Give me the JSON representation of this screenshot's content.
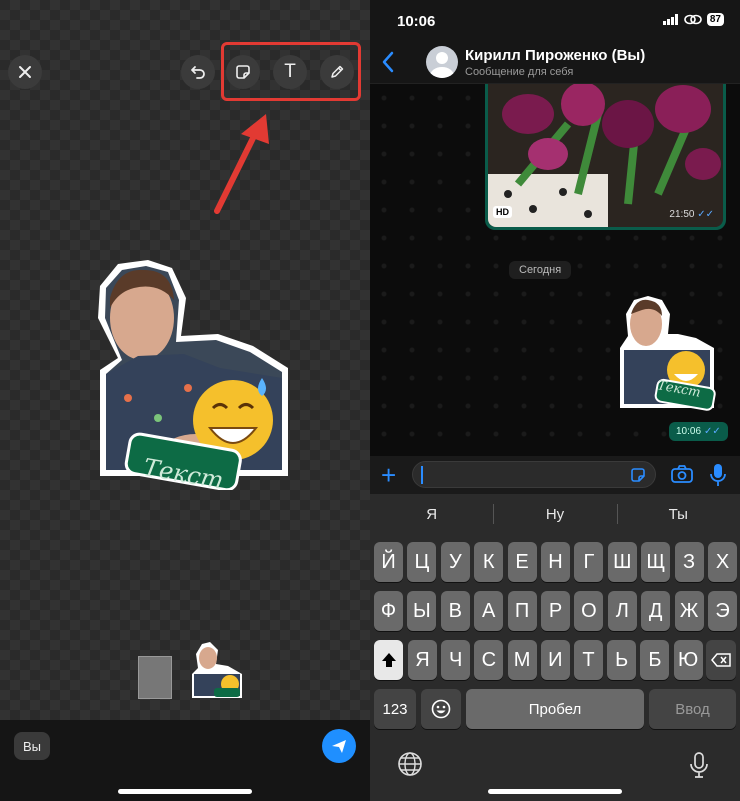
{
  "editor": {
    "close_icon": "close-icon",
    "undo_icon": "undo-icon",
    "sticker_icon": "sticker-icon",
    "text_tool_label": "T",
    "draw_icon": "pencil-icon",
    "sticker_text": "Текст",
    "recipient_chip": "Вы",
    "send_icon": "send-icon",
    "highlight_color": "#e23a33",
    "send_color": "#1f8fff"
  },
  "status": {
    "time": "10:06",
    "battery": "87"
  },
  "chat": {
    "contact_name": "Кирилл Пироженко (Вы)",
    "contact_subtitle": "Сообщение для себя",
    "photo_badge": "HD",
    "photo_time": "21:50",
    "date_separator": "Сегодня",
    "sticker_text": "Текст",
    "sticker_time": "10:06",
    "bubble_color": "#0a5c4a"
  },
  "keyboard": {
    "suggestions": [
      "Я",
      "Ну",
      "Ты"
    ],
    "row1": [
      "Й",
      "Ц",
      "У",
      "К",
      "Е",
      "Н",
      "Г",
      "Ш",
      "Щ",
      "З",
      "Х"
    ],
    "row2": [
      "Ф",
      "Ы",
      "В",
      "А",
      "П",
      "Р",
      "О",
      "Л",
      "Д",
      "Ж",
      "Э"
    ],
    "row3": [
      "Я",
      "Ч",
      "С",
      "М",
      "И",
      "Т",
      "Ь",
      "Б",
      "Ю"
    ],
    "numbers_key": "123",
    "space_key": "Пробел",
    "enter_key": "Ввод"
  }
}
